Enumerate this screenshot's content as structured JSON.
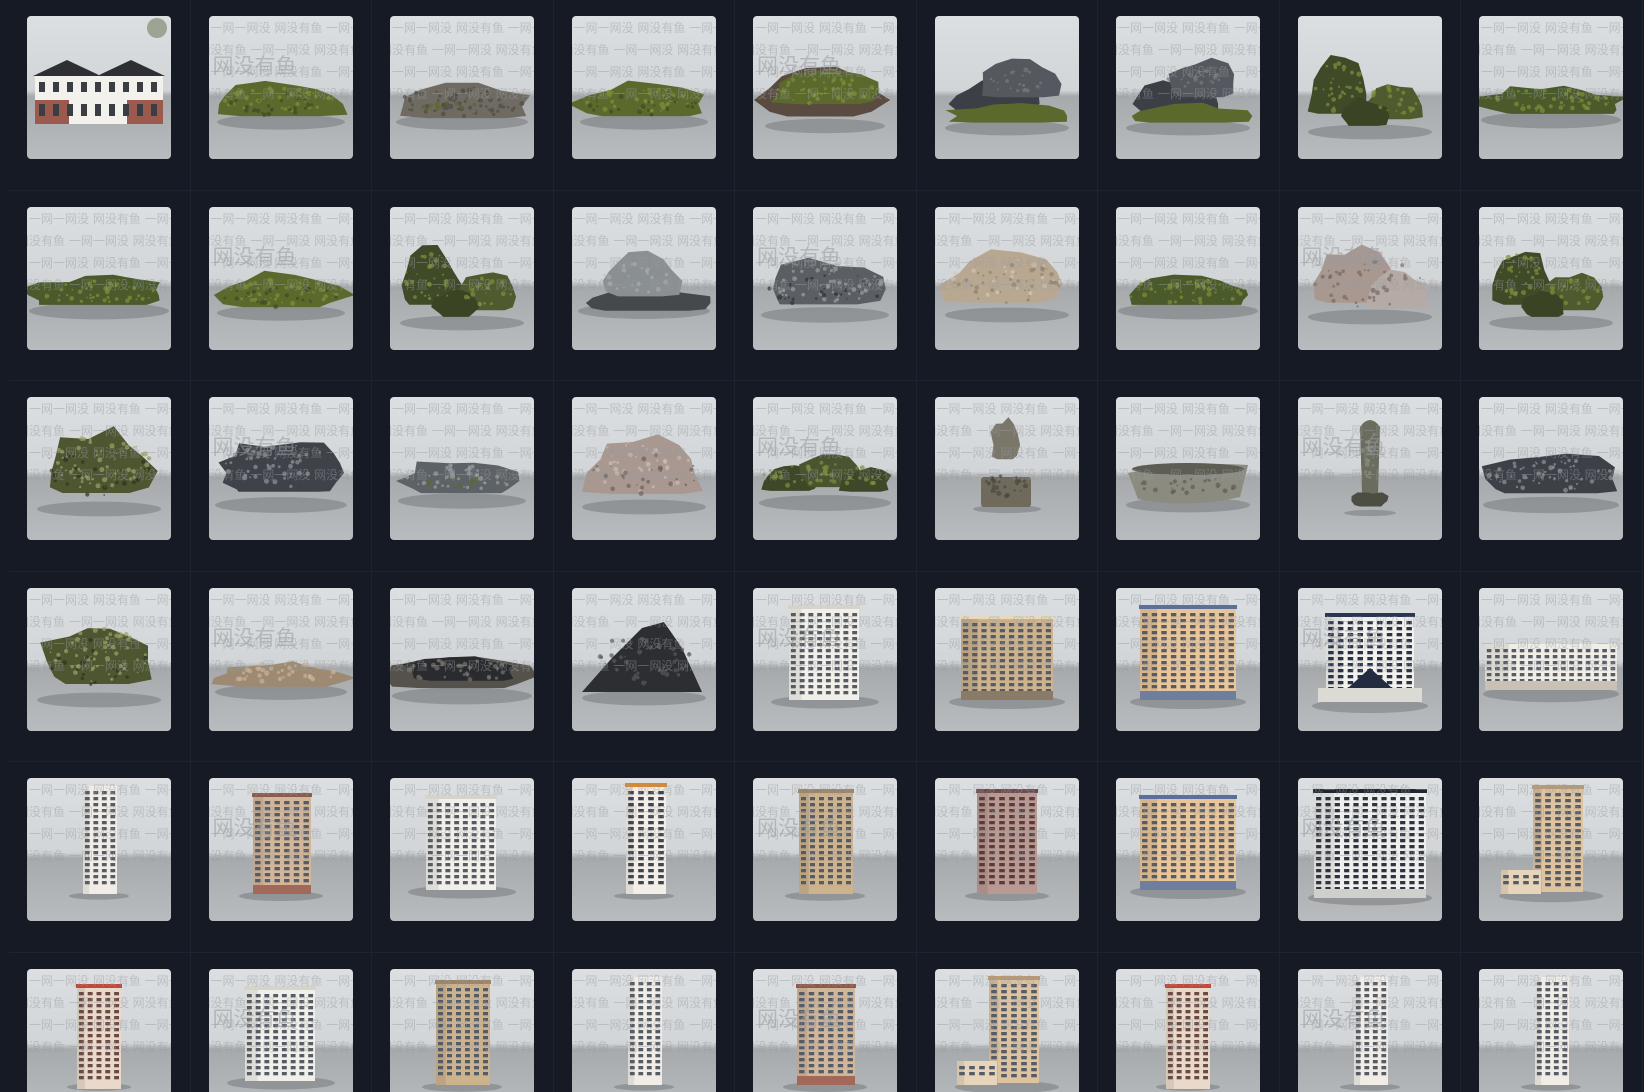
{
  "gallery": {
    "watermark_text": "网没有鱼",
    "watermark_dash": "一网一网没",
    "items": [
      {
        "kind": "house",
        "label": "house-model",
        "wm": false
      },
      {
        "kind": "rock-flat-moss",
        "label": "moss-rock",
        "wm": true
      },
      {
        "kind": "rock-flat-gravel",
        "label": "gravel-rock",
        "wm": true
      },
      {
        "kind": "rock-flat-moss",
        "label": "moss-rock",
        "wm": true
      },
      {
        "kind": "rock-moss-mound",
        "label": "moss-rock",
        "wm": true
      },
      {
        "kind": "rock-stack-dark",
        "label": "dark-rock",
        "wm": false
      },
      {
        "kind": "rock-stack-dark",
        "label": "dark-rock",
        "wm": true
      },
      {
        "kind": "rock-cluster-moss",
        "label": "moss-rock",
        "wm": false
      },
      {
        "kind": "rock-long-moss",
        "label": "moss-rock",
        "wm": true
      },
      {
        "kind": "rock-long-moss",
        "label": "moss-rock",
        "wm": true
      },
      {
        "kind": "rock-flat-moss",
        "label": "moss-rock",
        "wm": true
      },
      {
        "kind": "rock-cluster-moss",
        "label": "moss-rock",
        "wm": true
      },
      {
        "kind": "rock-slab-grey",
        "label": "grey-rock",
        "wm": true
      },
      {
        "kind": "rock-grey",
        "label": "grey-rock",
        "wm": true
      },
      {
        "kind": "rock-tan",
        "label": "tan-rock",
        "wm": true
      },
      {
        "kind": "rock-long-moss",
        "label": "moss-rock",
        "wm": true
      },
      {
        "kind": "rock-pink-pile",
        "label": "pink-rock",
        "wm": true
      },
      {
        "kind": "rock-cluster-moss",
        "label": "moss-rock",
        "wm": true
      },
      {
        "kind": "rock-moss-big",
        "label": "moss-rock",
        "wm": true
      },
      {
        "kind": "rock-dark-jagged",
        "label": "dark-rock",
        "wm": true
      },
      {
        "kind": "rock-flat-grey",
        "label": "grey-rock",
        "wm": true
      },
      {
        "kind": "rock-pink",
        "label": "pink-rock",
        "wm": true
      },
      {
        "kind": "rock-cluster-low",
        "label": "moss-rock",
        "wm": true
      },
      {
        "kind": "stone-pillar",
        "label": "stone-ornament",
        "wm": true
      },
      {
        "kind": "stone-trough",
        "label": "stone-trough",
        "wm": true
      },
      {
        "kind": "stone-spire",
        "label": "stone-spire",
        "wm": true
      },
      {
        "kind": "rock-dark-wide",
        "label": "dark-rock",
        "wm": true
      },
      {
        "kind": "rock-moss-big",
        "label": "moss-rock",
        "wm": true
      },
      {
        "kind": "rock-tan-flat",
        "label": "tan-rock",
        "wm": true
      },
      {
        "kind": "rock-dark-flat",
        "label": "dark-rock",
        "wm": true
      },
      {
        "kind": "rock-dark-peak",
        "label": "dark-rock",
        "wm": true
      },
      {
        "kind": "tower-white",
        "label": "apartment-building",
        "wm": true
      },
      {
        "kind": "tower-tan-wide",
        "label": "apartment-building",
        "wm": true
      },
      {
        "kind": "tower-orange",
        "label": "apartment-building",
        "wm": true
      },
      {
        "kind": "tower-dark-blue",
        "label": "apartment-building",
        "wm": true
      },
      {
        "kind": "tower-low-wide",
        "label": "apartment-building",
        "wm": true
      },
      {
        "kind": "tower-slim-white",
        "label": "apartment-building",
        "wm": true
      },
      {
        "kind": "tower-brick",
        "label": "apartment-building",
        "wm": true
      },
      {
        "kind": "tower-white",
        "label": "apartment-building",
        "wm": true
      },
      {
        "kind": "tower-slim-orange",
        "label": "apartment-building",
        "wm": true
      },
      {
        "kind": "tower-tan",
        "label": "apartment-building",
        "wm": true
      },
      {
        "kind": "tower-maroon",
        "label": "apartment-building",
        "wm": true
      },
      {
        "kind": "tower-orange",
        "label": "apartment-building",
        "wm": true
      },
      {
        "kind": "tower-dark-wide",
        "label": "apartment-building",
        "wm": true
      },
      {
        "kind": "tower-tan-step",
        "label": "apartment-building",
        "wm": true
      },
      {
        "kind": "tower-slim-red",
        "label": "apartment-building",
        "wm": true
      },
      {
        "kind": "tower-white",
        "label": "apartment-building",
        "wm": true
      },
      {
        "kind": "tower-tan",
        "label": "apartment-building",
        "wm": true
      },
      {
        "kind": "tower-slim-white",
        "label": "apartment-building",
        "wm": true
      },
      {
        "kind": "tower-brick",
        "label": "apartment-building",
        "wm": true
      },
      {
        "kind": "tower-tan-step",
        "label": "apartment-building",
        "wm": true
      },
      {
        "kind": "tower-slim-red",
        "label": "apartment-building",
        "wm": true
      },
      {
        "kind": "tower-slim-white",
        "label": "apartment-building",
        "wm": true
      },
      {
        "kind": "tower-slim-white",
        "label": "apartment-building",
        "wm": true
      }
    ]
  },
  "colors": {
    "background": "#161a24",
    "thumb_wall": "#d8dbdd",
    "thumb_floor": "#b3b6b8",
    "moss": "#5b6a2c",
    "moss_light": "#7f8f3a",
    "rock_dark": "#3c4046",
    "rock_grey": "#70757a",
    "rock_tan": "#b9a891",
    "rock_pink": "#a99890",
    "building_white": "#f1efe9",
    "building_tan": "#cdb28e",
    "building_orange": "#d99a63",
    "building_brick": "#a2685a",
    "building_dark": "#2d3545",
    "window": "#565c66"
  }
}
